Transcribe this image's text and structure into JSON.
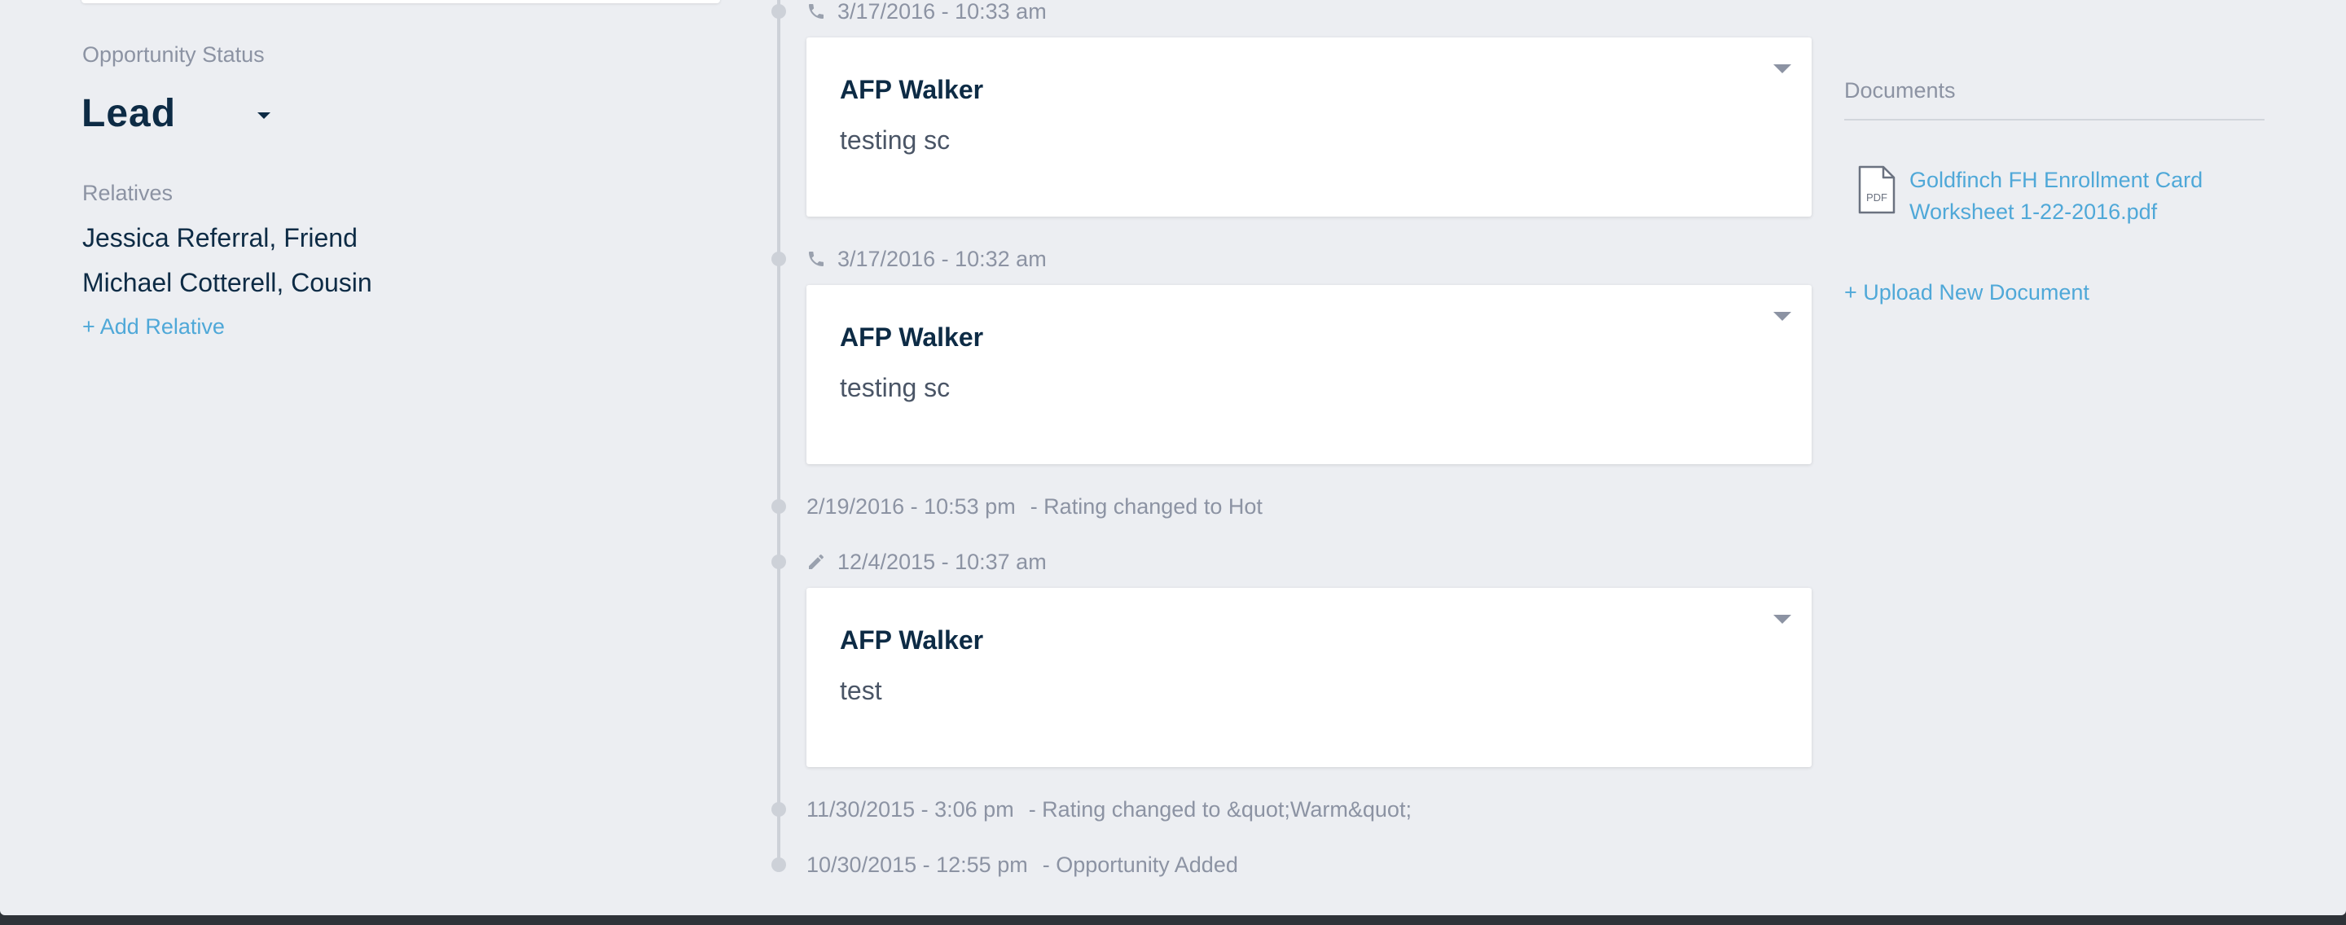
{
  "left": {
    "status_label": "Opportunity Status",
    "status_value": "Lead",
    "relatives_label": "Relatives",
    "relatives": [
      "Jessica Referral, Friend",
      "Michael Cotterell, Cousin"
    ],
    "add_relative": "+ Add Relative"
  },
  "timeline": {
    "events": [
      {
        "icon": "phone-icon",
        "timestamp": "3/17/2016 - 10:33 am",
        "author": "AFP Walker",
        "body": "testing sc"
      },
      {
        "icon": "phone-icon",
        "timestamp": "3/17/2016 - 10:32 am",
        "author": "AFP Walker",
        "body": "testing sc"
      },
      {
        "timestamp": "2/19/2016 - 10:53 pm",
        "note": "- Rating changed to Hot"
      },
      {
        "icon": "pencil-icon",
        "timestamp": "12/4/2015 - 10:37 am",
        "author": "AFP Walker",
        "body": "test"
      },
      {
        "timestamp": "11/30/2015 - 3:06 pm",
        "note": "- Rating changed to &quot;Warm&quot;"
      },
      {
        "timestamp": "10/30/2015 - 12:55 pm",
        "note": "- Opportunity Added"
      }
    ]
  },
  "documents": {
    "title": "Documents",
    "file_badge": "PDF",
    "files": [
      {
        "name_line1": "Goldfinch FH Enrollment Card",
        "name_line2": "Worksheet 1-22-2016.pdf"
      }
    ],
    "upload": "+ Upload New Document"
  },
  "colors": {
    "background": "#eceef2",
    "navy_text": "#0d2b45",
    "muted_text": "#8c93a3",
    "link": "#4fa8d8",
    "timeline": "#cdd1d8"
  }
}
